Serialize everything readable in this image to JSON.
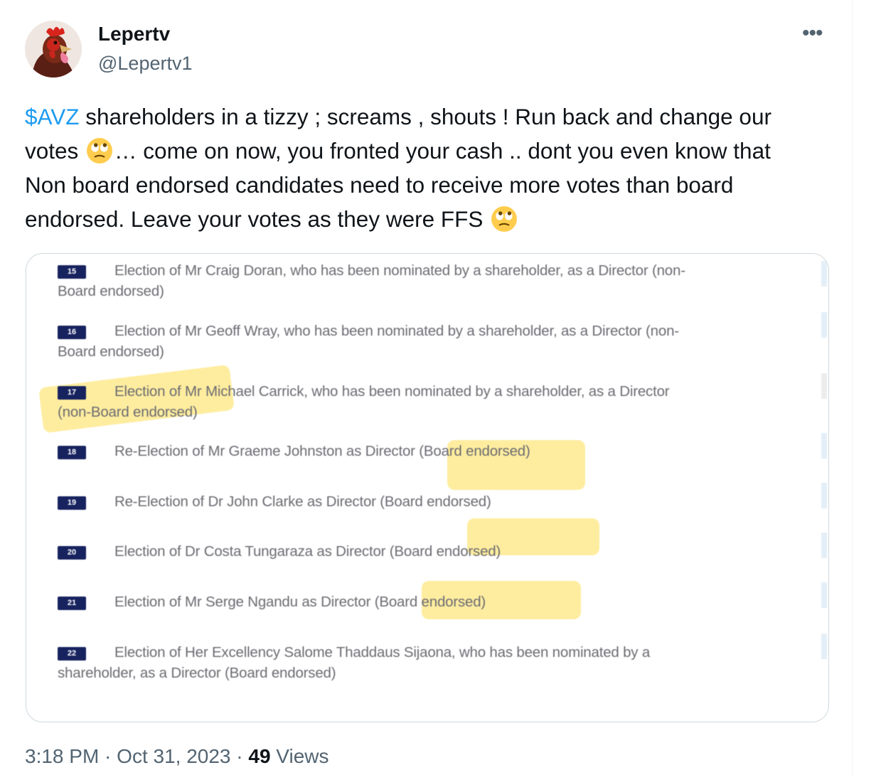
{
  "author": {
    "name": "Lepertv",
    "handle": "@Lepertv1"
  },
  "tweet": {
    "cashtag": "$AVZ",
    "text_part1": " shareholders in a tizzy ; screams , shouts ! Run back and change our votes ",
    "text_part2": "… come on now, you fronted your cash .. dont you even know that Non board endorsed candidates need to receive more votes than board endorsed. Leave your votes as they were FFS ",
    "emoji": "face-with-rolling-eyes",
    "timestamp": "3:18 PM · Oct 31, 2023 · ",
    "views_count": "49",
    "views_label": " Views"
  },
  "image": {
    "resolutions": [
      {
        "number": "15",
        "line1": "Election of Mr Craig Doran, who has been nominated by a shareholder, as a Director (non-",
        "line2": "Board endorsed)"
      },
      {
        "number": "16",
        "line1": "Election of Mr Geoff Wray, who has been nominated by a shareholder, as a Director (non-",
        "line2": "Board endorsed)"
      },
      {
        "number": "17",
        "line1": "Election of Mr Michael Carrick, who has been nominated by a shareholder, as a Director",
        "line2": "(non-Board endorsed)"
      },
      {
        "number": "18",
        "line1": "Re-Election of Mr Graeme Johnston as Director (Board endorsed)",
        "line2": ""
      },
      {
        "number": "19",
        "line1": "Re-Election of Dr John Clarke as Director (Board endorsed)",
        "line2": ""
      },
      {
        "number": "20",
        "line1": "Election of Dr Costa Tungaraza as Director (Board endorsed)",
        "line2": ""
      },
      {
        "number": "21",
        "line1": "Election of Mr Serge Ngandu as Director (Board endorsed)",
        "line2": ""
      },
      {
        "number": "22",
        "line1": "Election of Her Excellency Salome Thaddaus Sijaona, who has been nominated by a",
        "line2": "shareholder, as a Director (Board endorsed)"
      }
    ],
    "highlight_color": "#fdde50",
    "badge_color": "#17235f"
  },
  "colors": {
    "link": "#1d9bf0",
    "secondary_text": "#536471"
  }
}
